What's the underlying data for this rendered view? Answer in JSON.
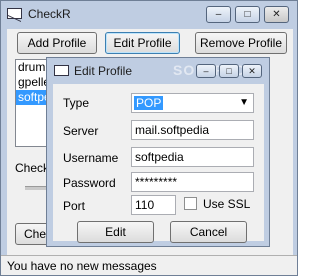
{
  "main_window": {
    "title": "CheckR",
    "controls": {
      "minimize": "–",
      "maximize": "□",
      "close": "✕"
    },
    "buttons": {
      "add_profile": "Add Profile",
      "edit_profile": "Edit Profile",
      "remove_profile": "Remove Profile"
    },
    "profiles": [
      {
        "label": "drumr",
        "selected": false
      },
      {
        "label": "gpelle",
        "selected": false
      },
      {
        "label": "softpe",
        "selected": true
      }
    ],
    "check_label": "Check",
    "check_button": "Che",
    "status": "You have no new messages"
  },
  "edit_dialog": {
    "title": "Edit Profile",
    "watermark": "SOFTPEDIA",
    "controls": {
      "minimize": "–",
      "maximize": "□",
      "close": "✕"
    },
    "fields": {
      "type_label": "Type",
      "type_value": "POP",
      "server_label": "Server",
      "server_value": "mail.softpedia",
      "username_label": "Username",
      "username_value": "softpedia",
      "password_label": "Password",
      "password_value": "*********",
      "port_label": "Port",
      "port_value": "110",
      "ssl_label": "Use SSL"
    },
    "ssl_checked": false,
    "buttons": {
      "edit": "Edit",
      "cancel": "Cancel"
    }
  }
}
